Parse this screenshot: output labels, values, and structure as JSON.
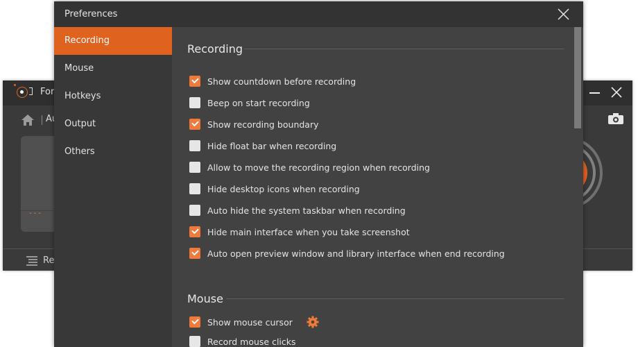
{
  "main_app": {
    "title": "Fon",
    "mode_label": "Au",
    "footer_label": "Rec",
    "icons": [
      "app-logo-icon",
      "home-icon",
      "camera-icon",
      "minimize-icon",
      "close-icon",
      "list-icon",
      "record-ring-icon"
    ]
  },
  "preferences": {
    "title": "Preferences",
    "close_icon": "close-icon",
    "sidebar": {
      "items": [
        {
          "label": "Recording",
          "active": true
        },
        {
          "label": "Mouse",
          "active": false
        },
        {
          "label": "Hotkeys",
          "active": false
        },
        {
          "label": "Output",
          "active": false
        },
        {
          "label": "Others",
          "active": false
        }
      ]
    },
    "sections": [
      {
        "title": "Recording",
        "options": [
          {
            "label": "Show countdown before recording",
            "checked": true
          },
          {
            "label": "Beep on start recording",
            "checked": false
          },
          {
            "label": "Show recording boundary",
            "checked": true
          },
          {
            "label": "Hide float bar when recording",
            "checked": false
          },
          {
            "label": "Allow to move the recording region when recording",
            "checked": false
          },
          {
            "label": "Hide desktop icons when recording",
            "checked": false
          },
          {
            "label": "Auto hide the system taskbar when recording",
            "checked": false
          },
          {
            "label": "Hide main interface when you take screenshot",
            "checked": true
          },
          {
            "label": "Auto open preview window and library interface when end recording",
            "checked": true
          }
        ]
      },
      {
        "title": "Mouse",
        "options": [
          {
            "label": "Show mouse cursor",
            "checked": true,
            "has_settings": true
          },
          {
            "label": "Record mouse clicks",
            "checked": false
          }
        ]
      }
    ]
  },
  "colors": {
    "accent": "#e0621f",
    "checkbox_on": "#f07a3a",
    "checkbox_off": "#e6e6e6",
    "dialog_bg": "#424242",
    "sidebar_bg": "#383838"
  }
}
